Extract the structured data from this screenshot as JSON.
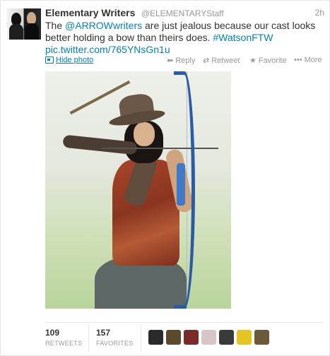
{
  "tweet": {
    "name": "Elementary Writers",
    "handle": "@ELEMENTARYStaff",
    "time": "2h",
    "text_before": "The ",
    "mention": "@ARROWwriters",
    "text_after": " are just jealous because our cast looks better holding a bow than theirs does. ",
    "hashtag": "#WatsonFTW",
    "link": "pic.twitter.com/765YNsGn1u"
  },
  "actions": {
    "hide_photo": "Hide photo",
    "reply": "Reply",
    "retweet": "Retweet",
    "favorite": "Favorite",
    "more": "More"
  },
  "icons": {
    "reply": "reply-arrow-icon",
    "retweet": "retweet-icon",
    "favorite": "star-icon",
    "more": "ellipsis-icon",
    "photo": "photo-icon"
  },
  "stats": {
    "retweets_count": "109",
    "retweets_label": "RETWEETS",
    "favorites_count": "157",
    "favorites_label": "FAVORITES"
  },
  "favoriters": [
    {
      "color": "#2a2a2a"
    },
    {
      "color": "#5c4a2e"
    },
    {
      "color": "#7a2a2a"
    },
    {
      "color": "#d8c6c6"
    },
    {
      "color": "#3a3a3a"
    },
    {
      "color": "#e6c520"
    },
    {
      "color": "#6b5a3a"
    }
  ],
  "colors": {
    "link": "#0084b4",
    "muted": "#999999",
    "text": "#333333"
  }
}
